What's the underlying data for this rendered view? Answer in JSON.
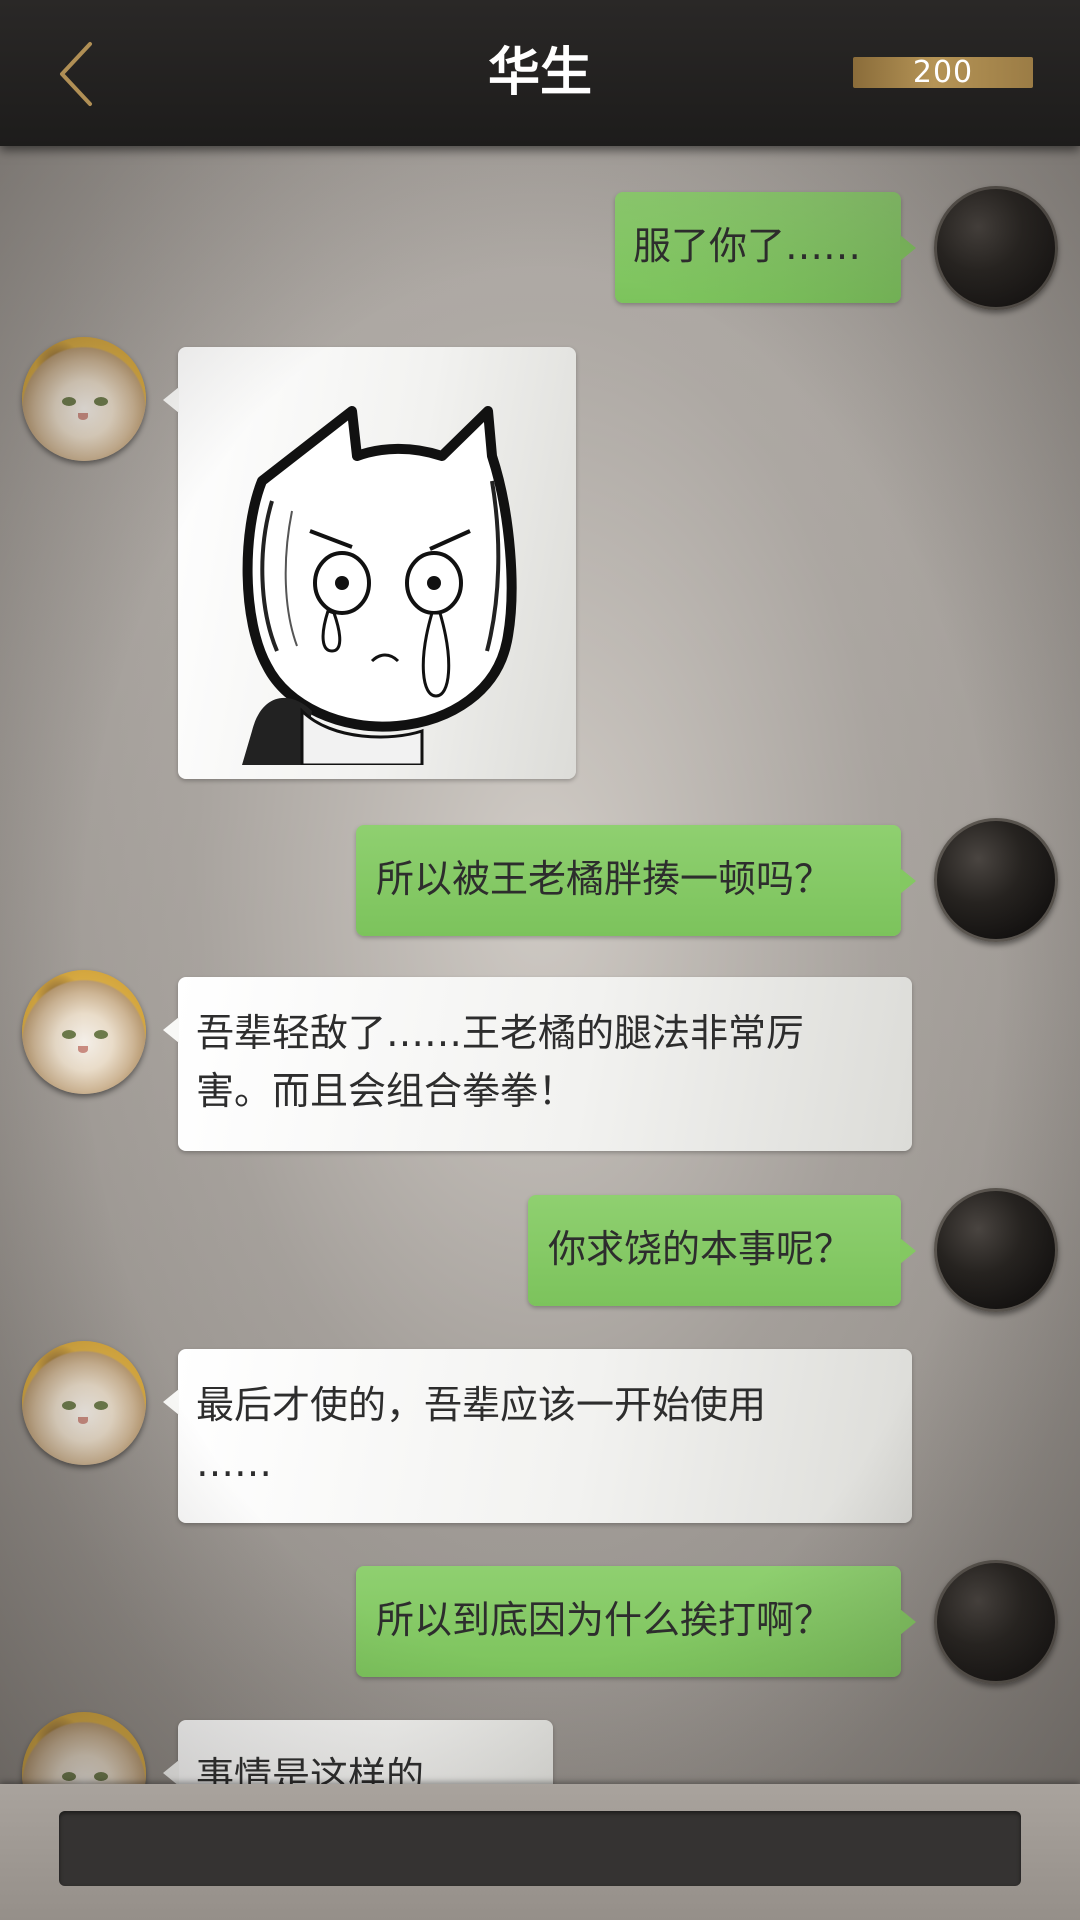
{
  "header": {
    "title": "华生",
    "back_icon": "chevron-left-icon",
    "coins": "200",
    "accent": "#b59456"
  },
  "messages": [
    {
      "side": "right",
      "type": "text",
      "text": "服了你了……"
    },
    {
      "side": "left",
      "type": "sticker",
      "sticker": "crying-cartoon-cat-sticker"
    },
    {
      "side": "right",
      "type": "text",
      "text": "所以被王老橘胖揍一顿吗？"
    },
    {
      "side": "left",
      "type": "text",
      "lines": [
        "吾辈轻敌了……王老橘的腿法非常厉",
        "害。而且会组合拳拳！"
      ]
    },
    {
      "side": "right",
      "type": "text",
      "text": "你求饶的本事呢？"
    },
    {
      "side": "left",
      "type": "text",
      "lines": [
        "最后才使的，吾辈应该一开始使用",
        "……"
      ]
    },
    {
      "side": "right",
      "type": "text",
      "text": "所以到底因为什么挨打啊？"
    },
    {
      "side": "left",
      "type": "text",
      "text": "事情是这样的……"
    }
  ],
  "colors": {
    "sent_bubble": "#84c862",
    "received_bubble": "#f4f4f2",
    "header_bg": "#222020",
    "reply_bar": "#353332"
  },
  "footer": {
    "reply_bar_value": ""
  }
}
